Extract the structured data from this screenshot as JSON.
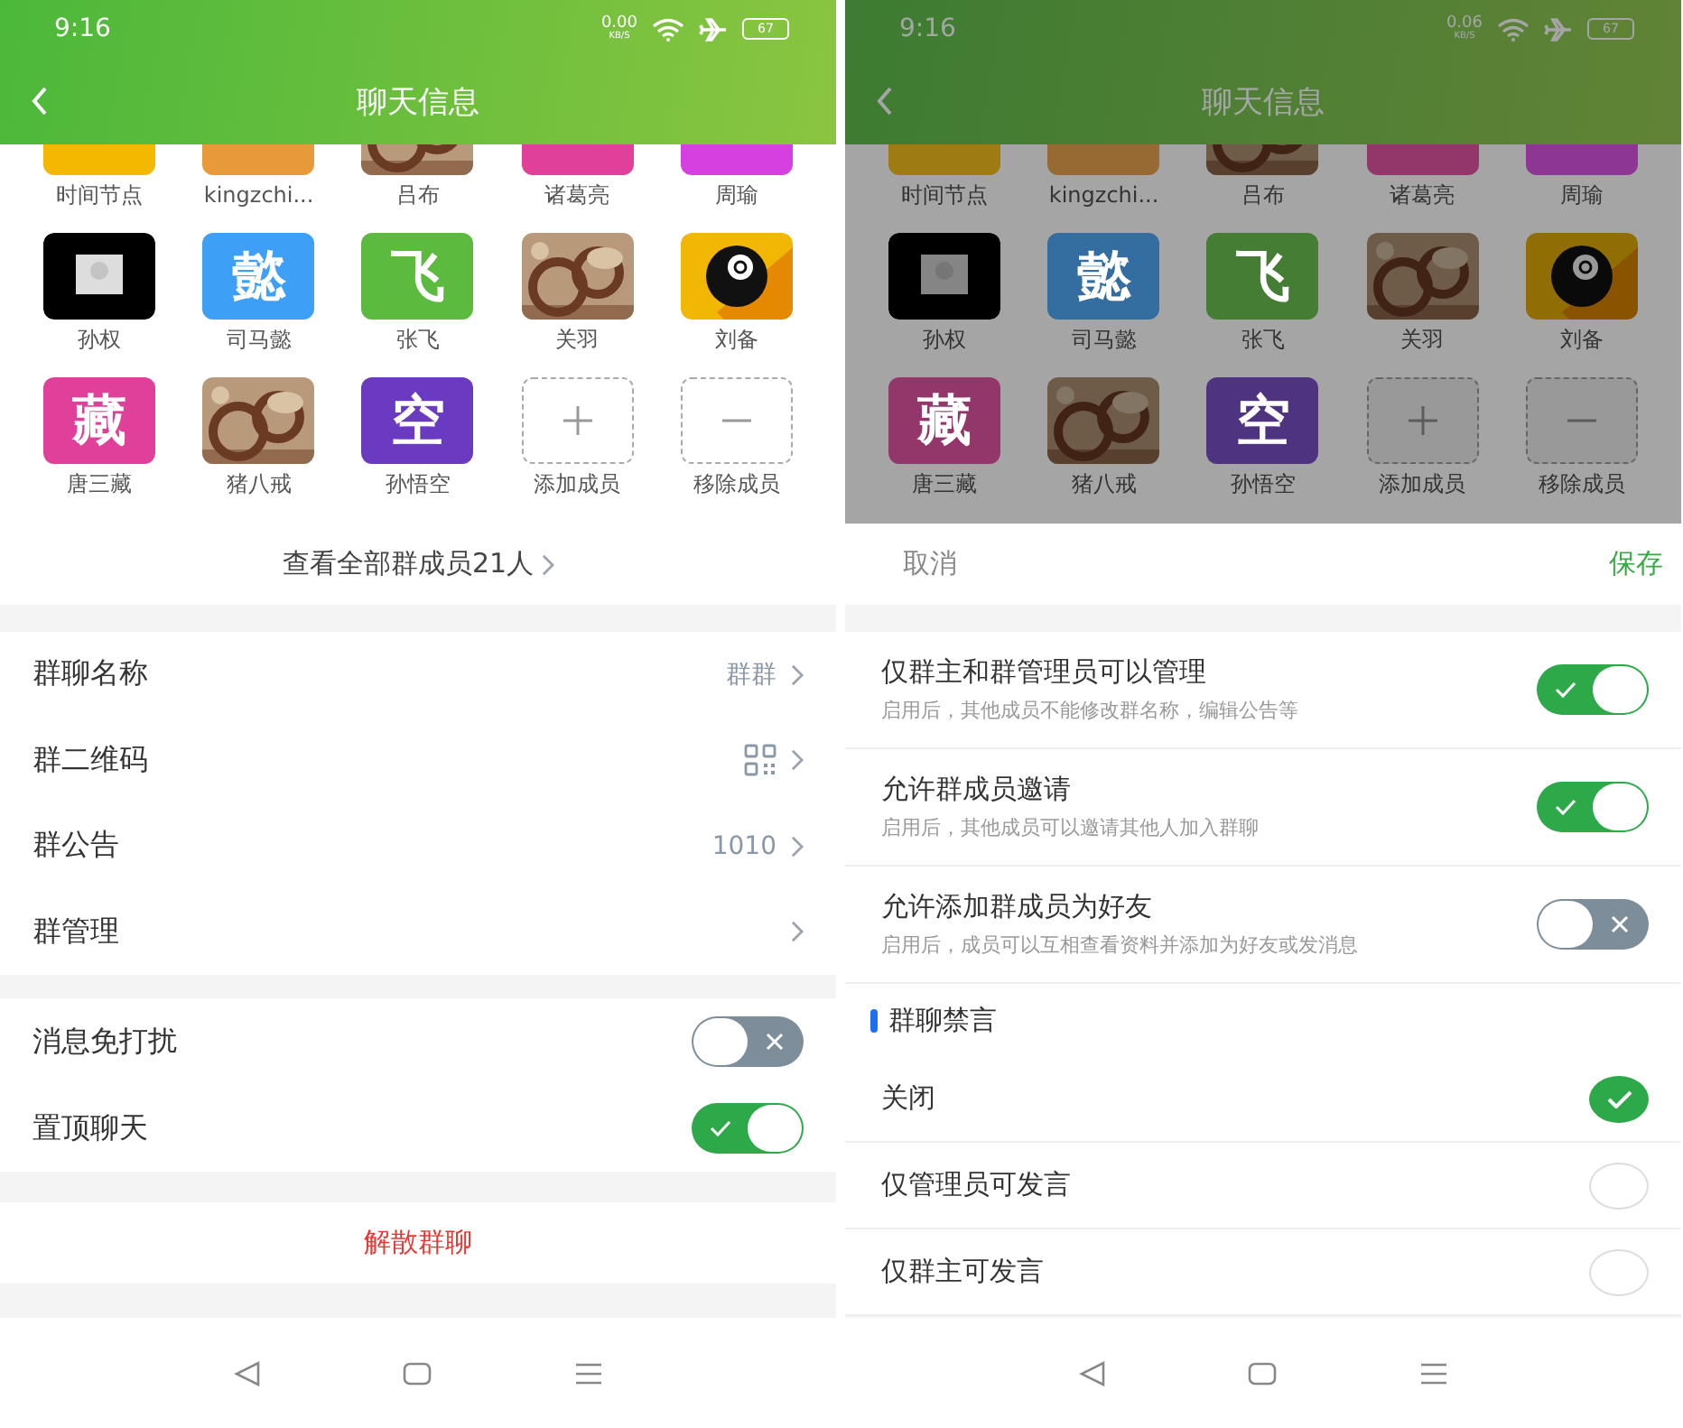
{
  "left": {
    "status": {
      "time": "9:16",
      "speed": "0.00",
      "speed_unit": "KB/S",
      "battery": "67"
    },
    "header": {
      "title": "聊天信息"
    },
    "members": [
      {
        "name": "时间节点",
        "kind": "block",
        "color": "#f5b800"
      },
      {
        "name": "kingzchi...",
        "kind": "block",
        "color": "#e89a3a"
      },
      {
        "name": "吕布",
        "kind": "picture"
      },
      {
        "name": "诸葛亮",
        "kind": "block",
        "color": "#e0409a"
      },
      {
        "name": "周瑜",
        "kind": "block",
        "color": "#d63fe0"
      },
      {
        "name": "孙权",
        "kind": "placeholder"
      },
      {
        "name": "司马懿",
        "kind": "letter",
        "glyph": "懿",
        "color": "#3d9ff5"
      },
      {
        "name": "张飞",
        "kind": "letter",
        "glyph": "飞",
        "color": "#5cbb3e"
      },
      {
        "name": "关羽",
        "kind": "picture"
      },
      {
        "name": "刘备",
        "kind": "ball"
      },
      {
        "name": "唐三藏",
        "kind": "letter",
        "glyph": "藏",
        "color": "#e0409a"
      },
      {
        "name": "猪八戒",
        "kind": "picture"
      },
      {
        "name": "孙悟空",
        "kind": "letter",
        "glyph": "空",
        "color": "#6a3bc0"
      },
      {
        "name": "添加成员",
        "kind": "add"
      },
      {
        "name": "移除成员",
        "kind": "remove"
      }
    ],
    "view_all": "查看全部群成员21人",
    "rows": [
      {
        "label": "群聊名称",
        "kind": "text",
        "value": "群群"
      },
      {
        "label": "群二维码",
        "kind": "qr"
      },
      {
        "label": "群公告",
        "kind": "text",
        "value": "1010"
      },
      {
        "label": "群管理",
        "kind": "plain"
      }
    ],
    "toggles": [
      {
        "label": "消息免打扰",
        "on": false
      },
      {
        "label": "置顶聊天",
        "on": true
      }
    ],
    "dissolve": "解散群聊"
  },
  "right": {
    "status": {
      "time": "9:16",
      "speed": "0.06",
      "speed_unit": "KB/S",
      "battery": "67"
    },
    "header": {
      "title": "聊天信息"
    },
    "members": [
      {
        "name": "时间节点",
        "kind": "block",
        "color": "#9f7c11"
      },
      {
        "name": "kingzchi...",
        "kind": "block",
        "color": "#986a33"
      },
      {
        "name": "吕布",
        "kind": "picture"
      },
      {
        "name": "诸葛亮",
        "kind": "block",
        "color": "#93366a"
      },
      {
        "name": "周瑜",
        "kind": "block",
        "color": "#8d3693"
      },
      {
        "name": "孙权",
        "kind": "placeholder"
      },
      {
        "name": "司马懿",
        "kind": "letter",
        "glyph": "懿",
        "color": "#346d9f"
      },
      {
        "name": "张飞",
        "kind": "letter",
        "glyph": "飞",
        "color": "#467d35"
      },
      {
        "name": "关羽",
        "kind": "picture"
      },
      {
        "name": "刘备",
        "kind": "ball"
      },
      {
        "name": "唐三藏",
        "kind": "letter",
        "glyph": "藏",
        "color": "#93366a"
      },
      {
        "name": "猪八戒",
        "kind": "picture"
      },
      {
        "name": "孙悟空",
        "kind": "letter",
        "glyph": "空",
        "color": "#4e3380"
      },
      {
        "name": "添加成员",
        "kind": "add"
      },
      {
        "name": "移除成员",
        "kind": "remove"
      }
    ],
    "sheet": {
      "cancel": "取消",
      "save": "保存",
      "toggles": [
        {
          "label": "仅群主和群管理员可以管理",
          "hint": "启用后，其他成员不能修改群名称，编辑公告等",
          "on": true
        },
        {
          "label": "允许群成员邀请",
          "hint": "启用后，其他成员可以邀请其他人加入群聊",
          "on": true
        },
        {
          "label": "允许添加群成员为好友",
          "hint": "启用后，成员可以互相查看资料并添加为好友或发消息",
          "on": false
        }
      ],
      "section": "群聊禁言",
      "options": [
        {
          "label": "关闭",
          "selected": true
        },
        {
          "label": "仅管理员可发言",
          "selected": false
        },
        {
          "label": "仅群主可发言",
          "selected": false
        }
      ]
    }
  }
}
